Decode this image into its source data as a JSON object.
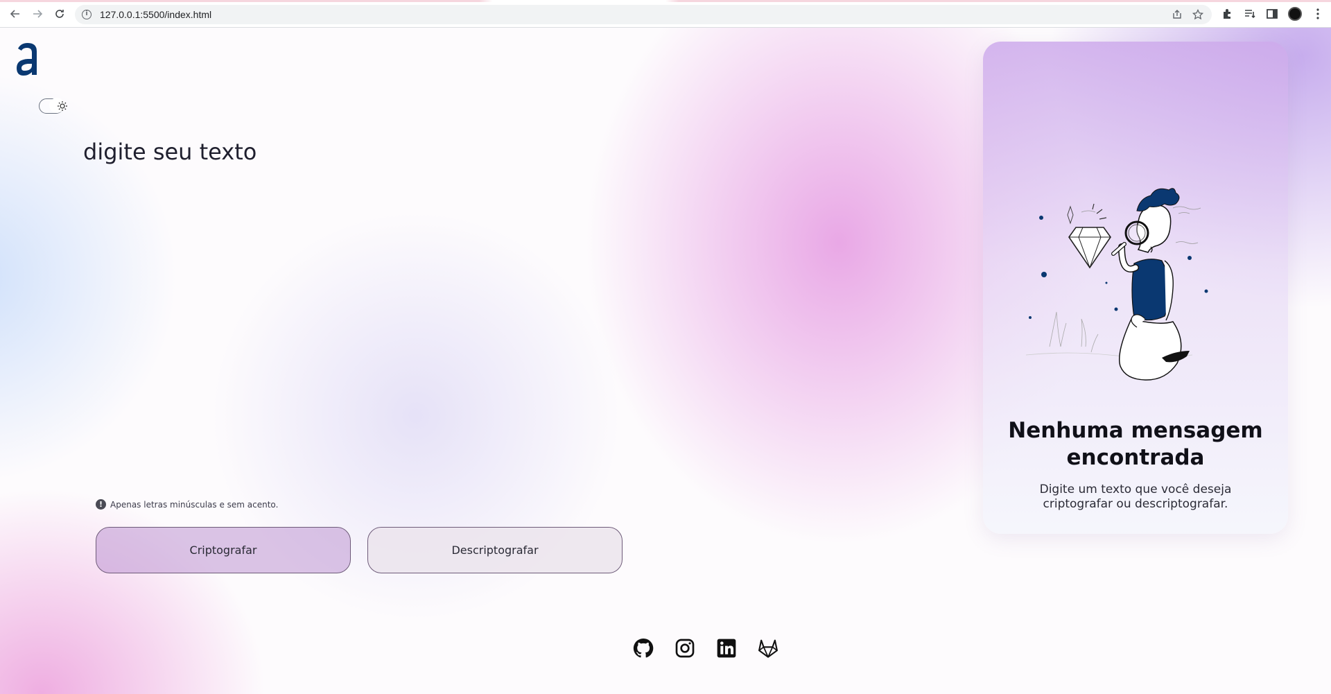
{
  "browser": {
    "url": "127.0.0.1:5500/index.html"
  },
  "app": {
    "logo_letter": "a",
    "brand_color": "#0a3871",
    "accent_color": "#d08ae0"
  },
  "editor": {
    "placeholder": "digite seu texto",
    "hint": "Apenas letras minúsculas e sem acento."
  },
  "actions": {
    "encrypt_label": "Criptografar",
    "decrypt_label": "Descriptografar"
  },
  "output": {
    "title": "Nenhuma mensagem encontrada",
    "subtitle": "Digite um texto que você deseja criptografar ou descriptografar."
  },
  "social": [
    "github-icon",
    "instagram-icon",
    "linkedin-icon",
    "gitlab-icon"
  ]
}
